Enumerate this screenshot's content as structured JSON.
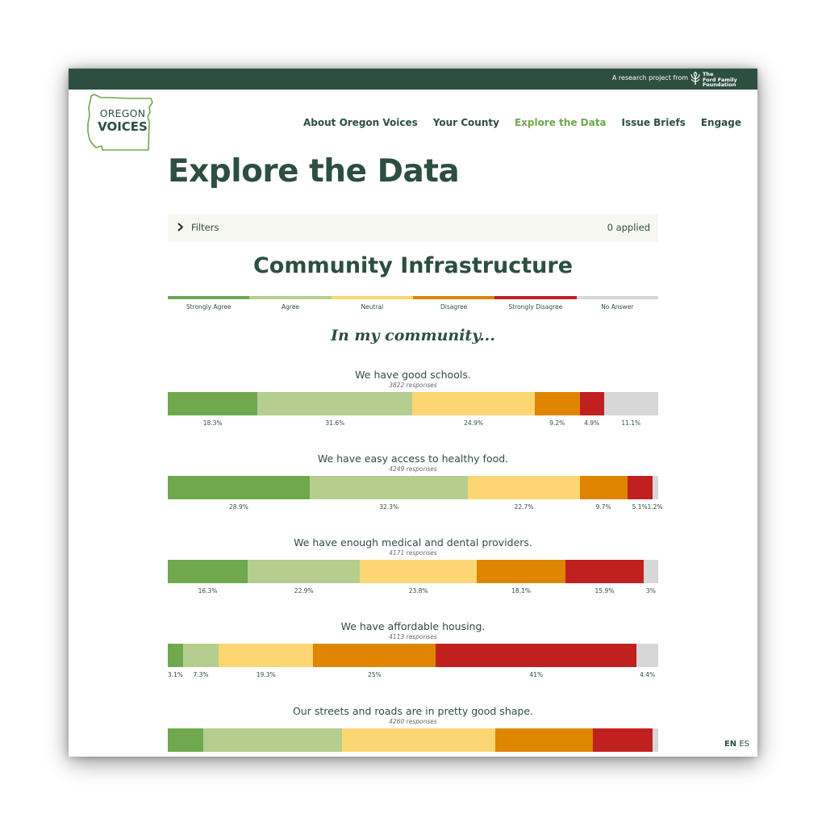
{
  "topbar": {
    "research_text": "A research project from",
    "ford_logo": {
      "icon": "ford-foundation-tree-icon",
      "lines": [
        "The",
        "Ford Family",
        "Foundation"
      ]
    }
  },
  "logo": {
    "line1": "OREGON",
    "line2": "VOICES",
    "icon": "oregon-state-outline-icon"
  },
  "nav": {
    "items": [
      "About Oregon Voices",
      "Your County",
      "Explore the Data",
      "Issue Briefs",
      "Engage"
    ],
    "active_index": 2
  },
  "page_title": "Explore the Data",
  "filters": {
    "label": "Filters",
    "count_text": "0 applied",
    "icon": "chevron-right-icon"
  },
  "section_title": "Community Infrastructure",
  "legend": [
    "Strongly Agree",
    "Agree",
    "Neutral",
    "Disagree",
    "Strongly Disagree",
    "No Answer"
  ],
  "colors": {
    "strongly_agree": "#6fa84f",
    "agree": "#b5cd8f",
    "neutral": "#fbd673",
    "disagree": "#df8500",
    "strongly_disagree": "#c02120",
    "no_answer": "#d7d7d7",
    "brand_dark_green": "#2c4f3f",
    "nav_active": "#6fa84a"
  },
  "subtitle": "In my community...",
  "questions": [
    {
      "title": "We have good schools.",
      "responses": "3822 responses",
      "values": [
        18.3,
        31.6,
        24.9,
        9.2,
        4.9,
        11.1
      ],
      "labels": [
        "18.3%",
        "31.6%",
        "24.9%",
        "9.2%",
        "4.9%",
        "11.1%"
      ]
    },
    {
      "title": "We have easy access to healthy food.",
      "responses": "4249 responses",
      "values": [
        28.9,
        32.3,
        22.7,
        9.7,
        5.1,
        1.2
      ],
      "labels": [
        "28.9%",
        "32.3%",
        "22.7%",
        "9.7%",
        "5.1%",
        "1.2%"
      ]
    },
    {
      "title": "We have enough medical and dental providers.",
      "responses": "4171 responses",
      "values": [
        16.3,
        22.9,
        23.8,
        18.1,
        15.9,
        3
      ],
      "labels": [
        "16.3%",
        "22.9%",
        "23.8%",
        "18.1%",
        "15.9%",
        "3%"
      ]
    },
    {
      "title": "We have affordable housing.",
      "responses": "4113 responses",
      "values": [
        3.1,
        7.3,
        19.3,
        25,
        41,
        4.4
      ],
      "labels": [
        "3.1%",
        "7.3%",
        "19.3%",
        "25%",
        "41%",
        "4.4%"
      ]
    },
    {
      "title": "Our streets and roads are in pretty good shape.",
      "responses": "4260 responses",
      "values": [
        7.3,
        28.2,
        31.2,
        20,
        12.1,
        1.2
      ],
      "labels": []
    }
  ],
  "lang": {
    "active": "EN",
    "other": "ES"
  }
}
